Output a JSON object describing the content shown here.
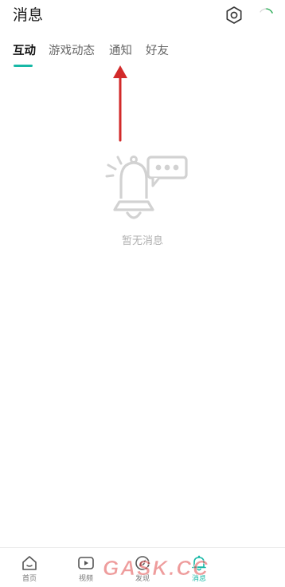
{
  "header": {
    "title": "消息",
    "settings_icon": "settings-hexagon-icon",
    "loading_icon": "loading-spinner-icon"
  },
  "tabs": [
    {
      "label": "互动",
      "active": true
    },
    {
      "label": "游戏动态",
      "active": false
    },
    {
      "label": "通知",
      "active": false
    },
    {
      "label": "好友",
      "active": false
    }
  ],
  "empty_state": {
    "icon": "bell-chat-icon",
    "text": "暂无消息"
  },
  "bottom_nav": [
    {
      "label": "首页",
      "icon": "home-icon",
      "active": false
    },
    {
      "label": "视频",
      "icon": "video-icon",
      "active": false
    },
    {
      "label": "发现",
      "icon": "discover-icon",
      "active": false
    },
    {
      "label": "消息",
      "icon": "bell-icon",
      "active": true
    }
  ],
  "watermark": {
    "text": "GASK.CC"
  },
  "colors": {
    "accent": "#17b8a6",
    "annotation_arrow": "#d22a2a",
    "empty_text": "#b0b0b0",
    "watermark": "#e04a4a"
  }
}
